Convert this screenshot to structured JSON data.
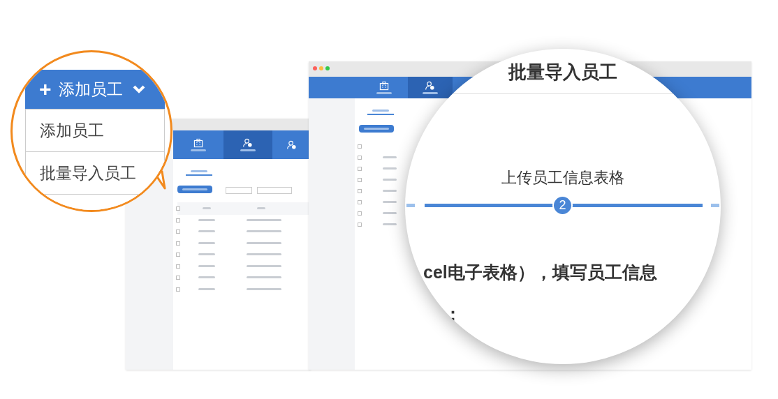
{
  "back_window": {
    "nav": [
      {
        "selected": false
      },
      {
        "selected": true
      }
    ],
    "rows": [
      {
        "checked": false
      },
      {
        "checked": false
      },
      {
        "checked": false
      },
      {
        "checked": false
      },
      {
        "checked": false
      },
      {
        "checked": false
      },
      {
        "checked": false
      },
      {
        "checked": false
      }
    ]
  },
  "front_window": {
    "nav": [
      {
        "selected": false
      },
      {
        "selected": true
      }
    ],
    "rows": [
      {
        "checked": false
      },
      {
        "checked": false
      },
      {
        "checked": false
      },
      {
        "checked": false
      },
      {
        "checked": false
      },
      {
        "checked": false
      },
      {
        "checked": false
      },
      {
        "checked": false
      }
    ]
  },
  "magnifier": {
    "title": "批量导入员工",
    "step_label": "上传员工信息表格",
    "step_number": "2",
    "instruction": "cel电子表格），填写员工信息",
    "fragment": "："
  },
  "callout": {
    "button_icon": "+",
    "button": "添加员工",
    "menu": [
      "添加员工",
      "批量导入员工"
    ]
  }
}
